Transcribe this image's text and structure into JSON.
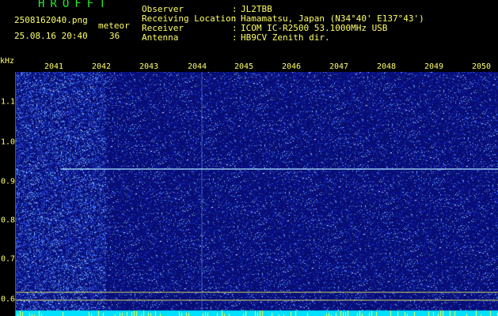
{
  "header": {
    "app_title": "HROFFT",
    "filename": "2508162040.png",
    "datetime": "25.08.16 20:40",
    "meteor_label": "meteor",
    "meteor_count": "36",
    "info": [
      {
        "label": "Observer",
        "value": "JL2TBB"
      },
      {
        "label": "Receiving Location",
        "value": "Hamamatsu, Japan (N34°40' E137°43')"
      },
      {
        "label": "Receiver",
        "value": "ICOM IC-R2500 53.1000MHz USB"
      },
      {
        "label": "Antenna",
        "value": "HB9CV Zenith dir."
      }
    ]
  },
  "axes": {
    "y_unit": "kHz",
    "x_ticks": [
      "2041",
      "2042",
      "2043",
      "2044",
      "2045",
      "2046",
      "2047",
      "2048",
      "2049",
      "2050"
    ],
    "y_ticks": [
      "1.1",
      "1.0",
      "0.9",
      "0.8",
      "0.7",
      "0.6"
    ]
  },
  "colors": {
    "background": "#000000",
    "noise_base": "#0a1a8a",
    "signal": "#9ad8ff",
    "grid": "#ffff66",
    "title": "#22ee22",
    "strip": "#00e0ff"
  }
}
